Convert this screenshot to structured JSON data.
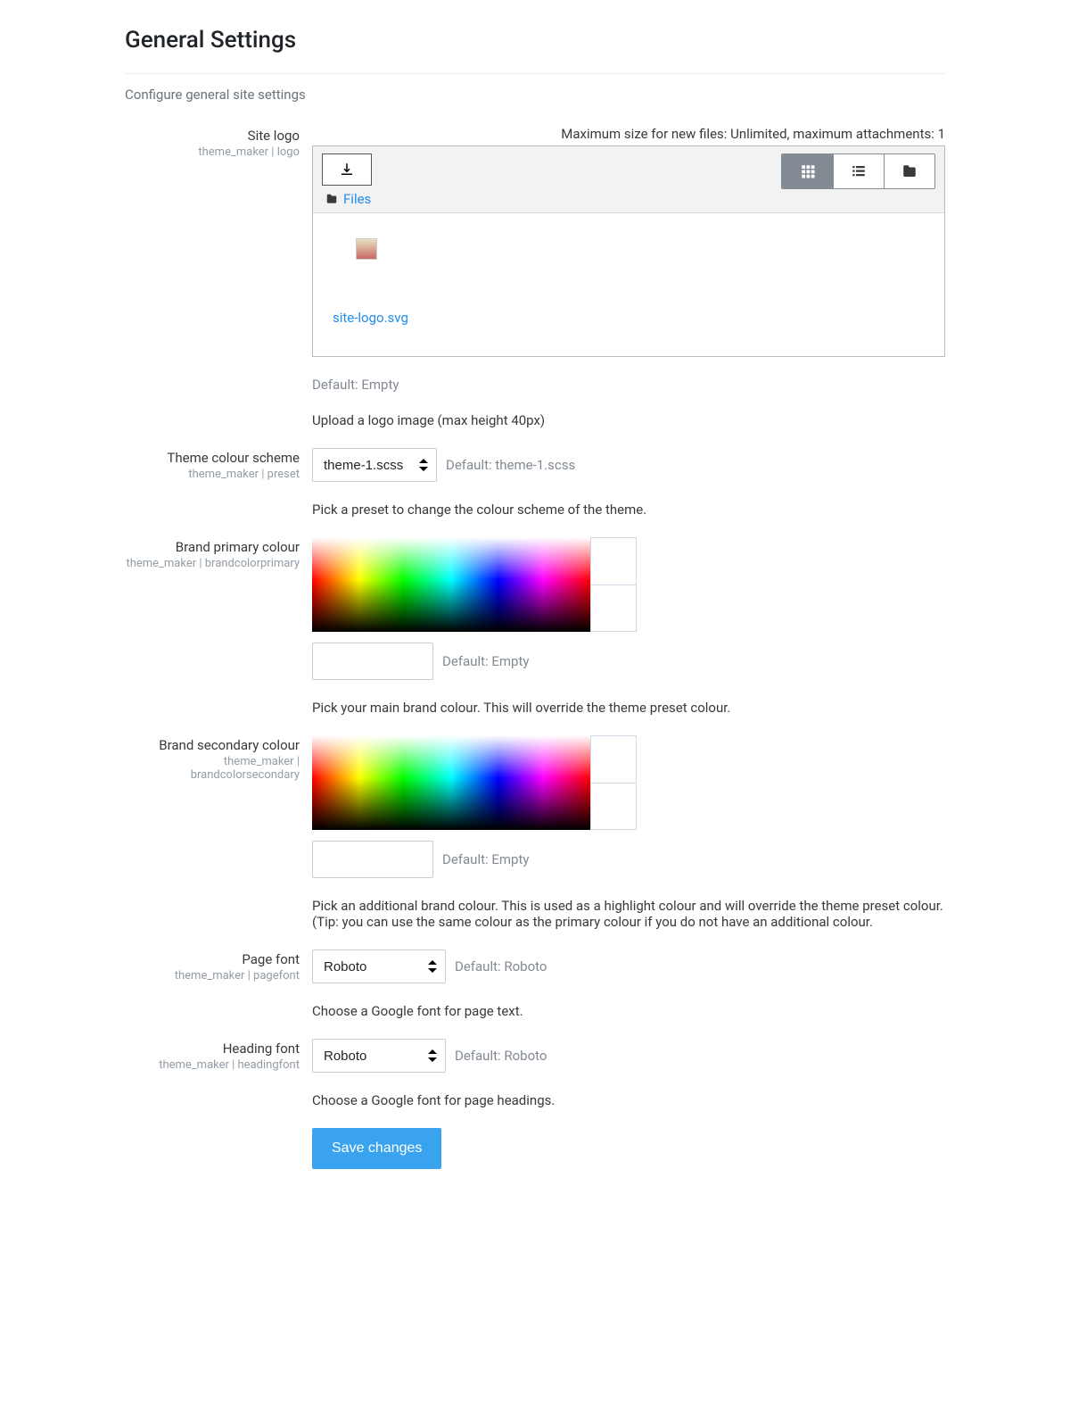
{
  "page": {
    "title": "General Settings",
    "subtitle": "Configure general site settings"
  },
  "logo": {
    "label": "Site logo",
    "sub": "theme_maker | logo",
    "file_limit": "Maximum size for new files: Unlimited, maximum attachments: 1",
    "files_label": "Files",
    "file_name": "site-logo.svg",
    "default": "Default: Empty",
    "desc": "Upload a logo image (max height 40px)"
  },
  "preset": {
    "label": "Theme colour scheme",
    "sub": "theme_maker | preset",
    "value": "theme-1.scss",
    "default": "Default: theme-1.scss",
    "desc": "Pick a preset to change the colour scheme of the theme."
  },
  "primary": {
    "label": "Brand primary colour",
    "sub": "theme_maker | brandcolorprimary",
    "value": "",
    "default": "Default: Empty",
    "desc": "Pick your main brand colour. This will override the theme preset colour."
  },
  "secondary": {
    "label": "Brand secondary colour",
    "sub": "theme_maker | brandcolorsecondary",
    "value": "",
    "default": "Default: Empty",
    "desc": "Pick an additional brand colour. This is used as a highlight colour and will override the theme preset colour. (Tip: you can use the same colour as the primary colour if you do not have an additional colour."
  },
  "pagefont": {
    "label": "Page font",
    "sub": "theme_maker | pagefont",
    "value": "Roboto",
    "default": "Default: Roboto",
    "desc": "Choose a Google font for page text."
  },
  "headingfont": {
    "label": "Heading font",
    "sub": "theme_maker | headingfont",
    "value": "Roboto",
    "default": "Default: Roboto",
    "desc": "Choose a Google font for page headings."
  },
  "actions": {
    "save": "Save changes"
  }
}
